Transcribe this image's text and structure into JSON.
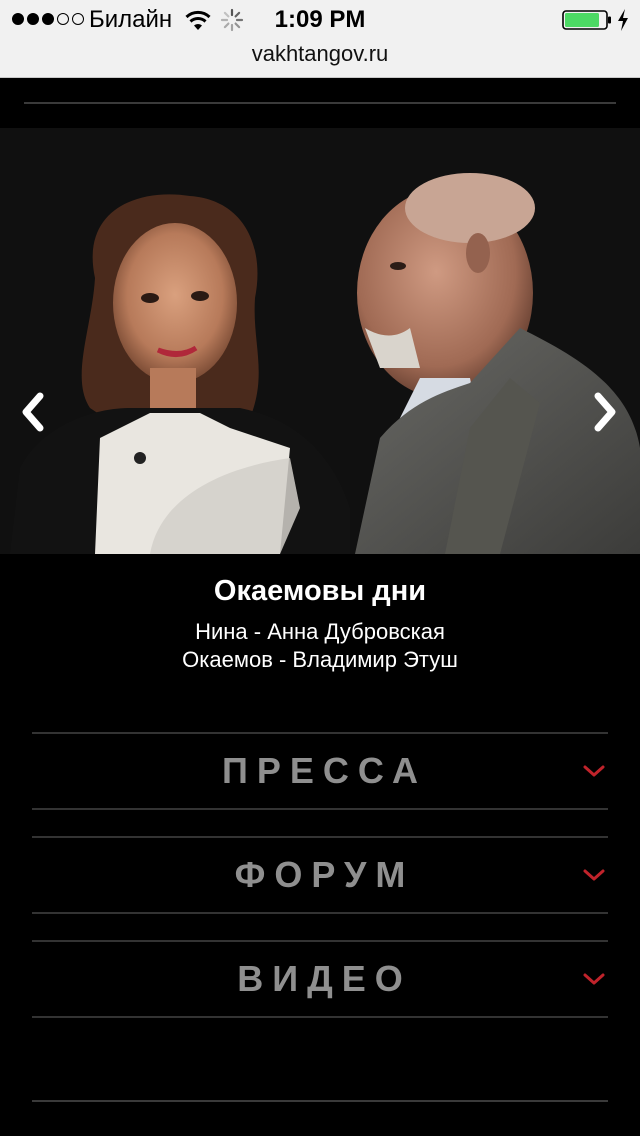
{
  "status_bar": {
    "carrier": "Билайн",
    "time": "1:09 PM",
    "signal_bars_full": 3,
    "signal_bars_total": 5,
    "battery_level": 0.85,
    "battery_color": "#4cd964",
    "icons": [
      "signal-dots-icon",
      "wifi-icon",
      "activity-spinner-icon",
      "battery-icon",
      "charging-bolt-icon"
    ]
  },
  "browser": {
    "url": "vakhtangov.ru"
  },
  "hero": {
    "prev_icon": "chevron-left-icon",
    "next_icon": "chevron-right-icon"
  },
  "caption": {
    "title": "Окаемовы дни",
    "cast": [
      "Нина - Анна Дубровская",
      "Окаемов - Владимир Этуш"
    ]
  },
  "sections": [
    {
      "label": "ПРЕССА",
      "icon": "chevron-down-icon"
    },
    {
      "label": "ФОРУМ",
      "icon": "chevron-down-icon"
    },
    {
      "label": "ВИДЕО",
      "icon": "chevron-down-icon"
    }
  ],
  "colors": {
    "background": "#000000",
    "section_label": "#8f8f8f",
    "chevron_accent": "#c0232b",
    "divider": "#333333"
  }
}
